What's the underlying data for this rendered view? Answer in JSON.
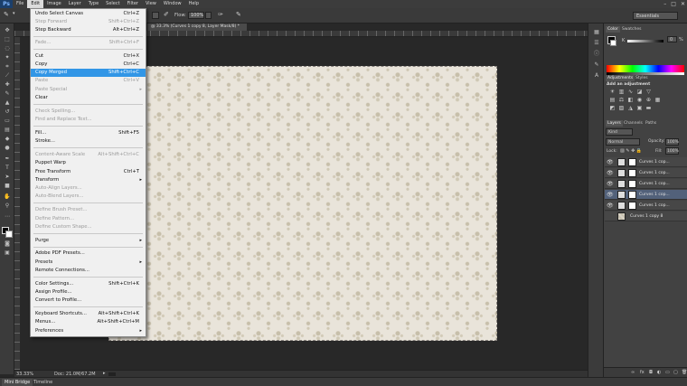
{
  "app": {
    "logo": "Ps",
    "menus": [
      "File",
      "Edit",
      "Image",
      "Layer",
      "Type",
      "Select",
      "Filter",
      "View",
      "Window",
      "Help"
    ],
    "active_menu": "Edit",
    "window_controls": [
      "–",
      "□",
      "✕"
    ]
  },
  "options_bar": {
    "flow_label": "Flow:",
    "flow_value": "100%",
    "workspace": "Essentials"
  },
  "document": {
    "tab_title": "@ 33.3% (Curves 1 copy 8, Layer Mask/8) *",
    "zoom": "33.33%",
    "doc_info": "Doc: 21.0M/67.2M"
  },
  "edit_menu": {
    "items": [
      {
        "label": "Undo Select Canvas",
        "shortcut": "Ctrl+Z",
        "disabled": false
      },
      {
        "label": "Step Forward",
        "shortcut": "Shift+Ctrl+Z",
        "disabled": true
      },
      {
        "label": "Step Backward",
        "shortcut": "Alt+Ctrl+Z",
        "disabled": false
      },
      {
        "label": "Fade...",
        "shortcut": "Shift+Ctrl+F",
        "disabled": true
      },
      {
        "label": "Cut",
        "shortcut": "Ctrl+X",
        "disabled": false
      },
      {
        "label": "Copy",
        "shortcut": "Ctrl+C",
        "disabled": false
      },
      {
        "label": "Copy Merged",
        "shortcut": "Shift+Ctrl+C",
        "disabled": false,
        "highlight": true
      },
      {
        "label": "Paste",
        "shortcut": "Ctrl+V",
        "disabled": true
      },
      {
        "label": "Paste Special",
        "shortcut": "",
        "disabled": true,
        "submenu": true
      },
      {
        "label": "Clear",
        "shortcut": "",
        "disabled": false
      },
      {
        "label": "Check Spelling...",
        "shortcut": "",
        "disabled": true
      },
      {
        "label": "Find and Replace Text...",
        "shortcut": "",
        "disabled": true
      },
      {
        "label": "Fill...",
        "shortcut": "Shift+F5",
        "disabled": false
      },
      {
        "label": "Stroke...",
        "shortcut": "",
        "disabled": false
      },
      {
        "label": "Content-Aware Scale",
        "shortcut": "Alt+Shift+Ctrl+C",
        "disabled": true
      },
      {
        "label": "Puppet Warp",
        "shortcut": "",
        "disabled": false
      },
      {
        "label": "Free Transform",
        "shortcut": "Ctrl+T",
        "disabled": false
      },
      {
        "label": "Transform",
        "shortcut": "",
        "disabled": false,
        "submenu": true
      },
      {
        "label": "Auto-Align Layers...",
        "shortcut": "",
        "disabled": true
      },
      {
        "label": "Auto-Blend Layers...",
        "shortcut": "",
        "disabled": true
      },
      {
        "label": "Define Brush Preset...",
        "shortcut": "",
        "disabled": true
      },
      {
        "label": "Define Pattern...",
        "shortcut": "",
        "disabled": true
      },
      {
        "label": "Define Custom Shape...",
        "shortcut": "",
        "disabled": true
      },
      {
        "label": "Purge",
        "shortcut": "",
        "disabled": false,
        "submenu": true
      },
      {
        "label": "Adobe PDF Presets...",
        "shortcut": "",
        "disabled": false
      },
      {
        "label": "Presets",
        "shortcut": "",
        "disabled": false,
        "submenu": true
      },
      {
        "label": "Remote Connections...",
        "shortcut": "",
        "disabled": false
      },
      {
        "label": "Color Settings...",
        "shortcut": "Shift+Ctrl+K",
        "disabled": false
      },
      {
        "label": "Assign Profile...",
        "shortcut": "",
        "disabled": false
      },
      {
        "label": "Convert to Profile...",
        "shortcut": "",
        "disabled": false
      },
      {
        "label": "Keyboard Shortcuts...",
        "shortcut": "Alt+Shift+Ctrl+K",
        "disabled": false
      },
      {
        "label": "Menus...",
        "shortcut": "Alt+Shift+Ctrl+M",
        "disabled": false
      },
      {
        "label": "Preferences",
        "shortcut": "",
        "disabled": false,
        "submenu": true
      }
    ]
  },
  "panels": {
    "color_tabs": [
      "Color",
      "Swatches"
    ],
    "adjustments_tabs": [
      "Adjustments",
      "Styles"
    ],
    "adjustments_heading": "Add an adjustment",
    "layers_tabs": [
      "Layers",
      "Channels",
      "Paths"
    ],
    "kind_filter": "Kind",
    "blend_mode": "Normal",
    "opacity_label": "Opacity:",
    "opacity_value": "100%",
    "lock_label": "Lock:",
    "fill_label": "Fill:",
    "fill_value": "100%",
    "k_value": "0",
    "k_unit": "%",
    "layers": [
      {
        "name": "Curves 1 cop...",
        "selected": false,
        "type": "curves"
      },
      {
        "name": "Curves 1 cop...",
        "selected": false,
        "type": "curves"
      },
      {
        "name": "Curves 1 cop...",
        "selected": false,
        "type": "curves"
      },
      {
        "name": "Curves 1 cop...",
        "selected": true,
        "type": "curves"
      },
      {
        "name": "Curves 1 cop...",
        "selected": false,
        "type": "curves"
      },
      {
        "name": "Curves 1 copy 8",
        "selected": false,
        "type": "pattern"
      }
    ]
  },
  "bottom_tabs": [
    "Mini Bridge",
    "Timeline"
  ]
}
